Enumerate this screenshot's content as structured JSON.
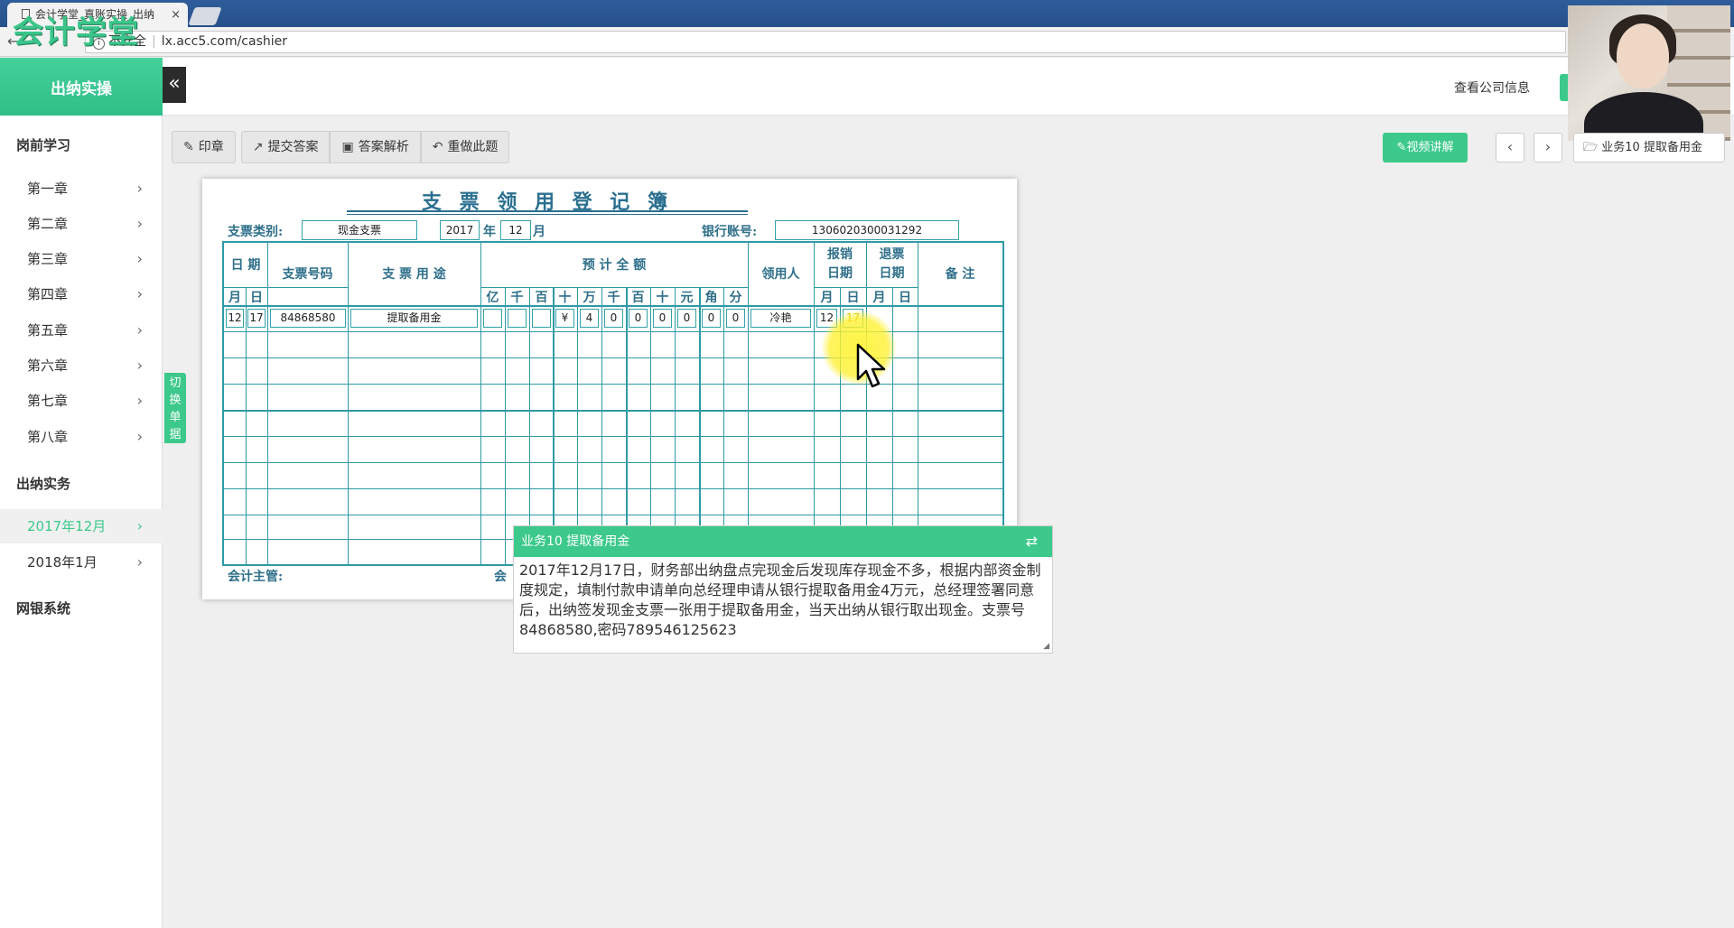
{
  "browser": {
    "tab_title": "会计学堂_真账实操_出纳",
    "tab_close": "×",
    "security_label": "不安全",
    "url": "lx.acc5.com/cashier",
    "logo_text": "会计学堂"
  },
  "header": {
    "brand": "出纳实操",
    "collapse_icon": "«",
    "company_info": "查看公司信息"
  },
  "sidebar": {
    "section1": "岗前学习",
    "chapters": [
      "第一章",
      "第二章",
      "第三章",
      "第四章",
      "第五章",
      "第六章",
      "第七章",
      "第八章"
    ],
    "section2": "出纳实务",
    "months": [
      "2017年12月",
      "2018年1月"
    ],
    "active_month": "2017年12月",
    "section3": "网银系统",
    "chevron": "›",
    "switch_tab": "切换单据"
  },
  "toolbar": {
    "stamp": "印章",
    "submit": "提交答案",
    "analysis": "答案解析",
    "redo": "重做此题",
    "video": "视频讲解",
    "prev": "‹",
    "next": "›",
    "task": "业务10 提取备用金"
  },
  "form": {
    "title": "支 票 领 用 登 记 簿",
    "type_label": "支票类别:",
    "type_value": "现金支票",
    "year": "2017",
    "year_label": "年",
    "month": "12",
    "month_label": "月",
    "account_label": "银行账号:",
    "account_value": "1306020300031292",
    "headers": {
      "date": "日 期",
      "month": "月",
      "day": "日",
      "check_no": "支票号码",
      "purpose": "支 票 用 途",
      "amount": "预 计 全 额",
      "digits": [
        "亿",
        "千",
        "百",
        "十",
        "万",
        "千",
        "百",
        "十",
        "元",
        "角",
        "分"
      ],
      "receiver": "领用人",
      "reimburse_a": "报销",
      "reimburse_b": "日期",
      "return_a": "退票",
      "return_b": "日期",
      "r_month": "月",
      "r_day": "日",
      "t_month": "月",
      "t_day": "日",
      "remark": "备 注"
    },
    "row": {
      "month": "12",
      "day": "17",
      "check_no": "84868580",
      "purpose": "提取备用金",
      "digits": [
        "",
        "",
        "",
        "¥",
        "4",
        "0",
        "0",
        "0",
        "0",
        "0",
        "0"
      ],
      "receiver": "冷艳",
      "r_month": "12",
      "r_day": "17"
    },
    "footer_supervisor": "会计主管:",
    "footer_partial": "会"
  },
  "task_popup": {
    "title": "业务10 提取备用金",
    "swap_icon": "⇄",
    "body": "2017年12月17日，财务部出纳盘点完现金后发现库存现金不多，根据内部资金制度规定，填制付款申请单向总经理申请从银行提取备用金4万元，总经理签署同意后，出纳签发现金支票一张用于提取备用金，当天出纳从银行取出现金。支票号84868580,密码789546125623",
    "resize_icon": "◢"
  }
}
